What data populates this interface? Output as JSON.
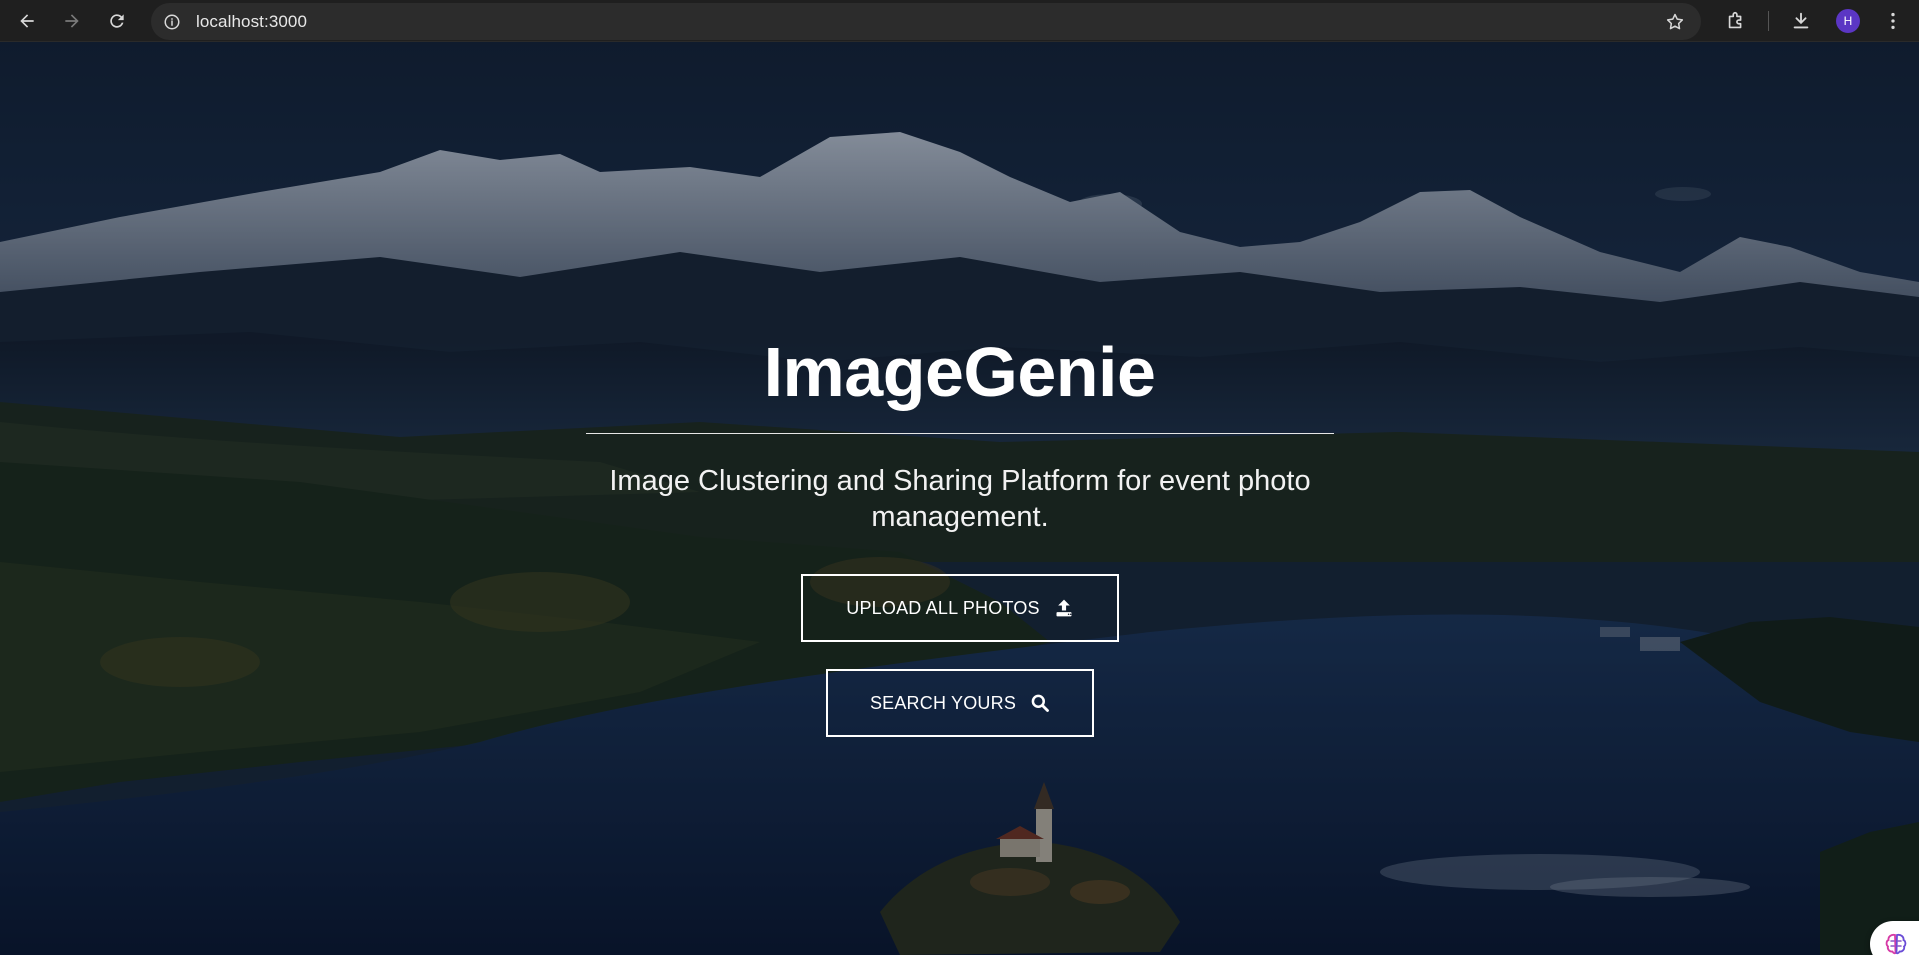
{
  "browser": {
    "url": "localhost:3000",
    "avatar_letter": "H",
    "avatar_color": "#5b36c4"
  },
  "hero": {
    "title": "ImageGenie",
    "subtitle": "Image Clustering and Sharing Platform for event photo management.",
    "upload_label": "UPLOAD ALL PHOTOS",
    "upload_icon": "upload-icon",
    "search_label": "SEARCH YOURS",
    "search_icon": "search-icon"
  },
  "colors": {
    "chrome": "#1f1f1f",
    "omnibox": "#2c2c2c",
    "text_on_hero": "#ffffff"
  }
}
